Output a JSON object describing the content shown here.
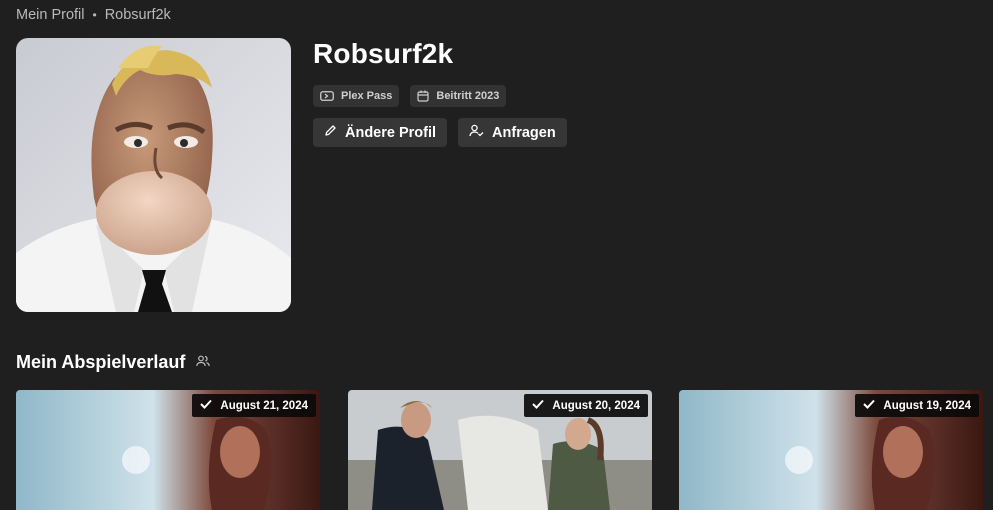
{
  "breadcrumb": {
    "parent": "Mein Profil",
    "separator": "•",
    "current": "Robsurf2k"
  },
  "profile": {
    "username": "Robsurf2k",
    "badges": [
      {
        "icon": "pass-icon",
        "label": "Plex Pass"
      },
      {
        "icon": "calendar-icon",
        "label": "Beitritt 2023"
      }
    ],
    "actions": {
      "edit_label": "Ändere Profil",
      "requests_label": "Anfragen"
    }
  },
  "history": {
    "title": "Mein Abspielverlauf",
    "icon": "users-icon",
    "items": [
      {
        "date": "August 21, 2024",
        "status_icon": "check-icon"
      },
      {
        "date": "August 20, 2024",
        "status_icon": "check-icon"
      },
      {
        "date": "August 19, 2024",
        "status_icon": "check-icon"
      }
    ]
  },
  "colors": {
    "background": "#1f1f1f",
    "surface": "#363636",
    "badge": "#333333",
    "text": "#ffffff",
    "muted": "#b9b9b9"
  }
}
